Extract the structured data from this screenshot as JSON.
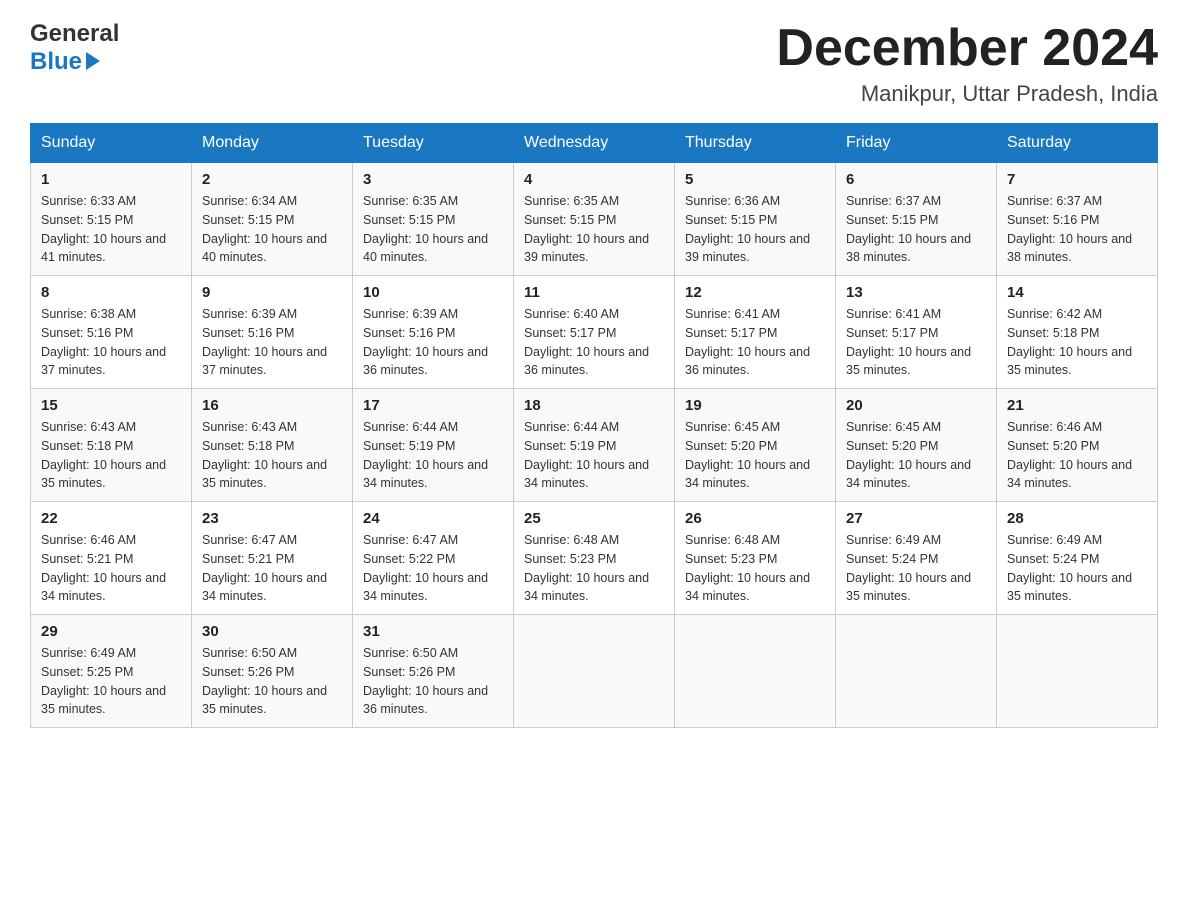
{
  "header": {
    "logo_general": "General",
    "logo_blue": "Blue",
    "month": "December 2024",
    "location": "Manikpur, Uttar Pradesh, India"
  },
  "weekdays": [
    "Sunday",
    "Monday",
    "Tuesday",
    "Wednesday",
    "Thursday",
    "Friday",
    "Saturday"
  ],
  "weeks": [
    [
      {
        "day": "1",
        "sunrise": "6:33 AM",
        "sunset": "5:15 PM",
        "daylight": "10 hours and 41 minutes."
      },
      {
        "day": "2",
        "sunrise": "6:34 AM",
        "sunset": "5:15 PM",
        "daylight": "10 hours and 40 minutes."
      },
      {
        "day": "3",
        "sunrise": "6:35 AM",
        "sunset": "5:15 PM",
        "daylight": "10 hours and 40 minutes."
      },
      {
        "day": "4",
        "sunrise": "6:35 AM",
        "sunset": "5:15 PM",
        "daylight": "10 hours and 39 minutes."
      },
      {
        "day": "5",
        "sunrise": "6:36 AM",
        "sunset": "5:15 PM",
        "daylight": "10 hours and 39 minutes."
      },
      {
        "day": "6",
        "sunrise": "6:37 AM",
        "sunset": "5:15 PM",
        "daylight": "10 hours and 38 minutes."
      },
      {
        "day": "7",
        "sunrise": "6:37 AM",
        "sunset": "5:16 PM",
        "daylight": "10 hours and 38 minutes."
      }
    ],
    [
      {
        "day": "8",
        "sunrise": "6:38 AM",
        "sunset": "5:16 PM",
        "daylight": "10 hours and 37 minutes."
      },
      {
        "day": "9",
        "sunrise": "6:39 AM",
        "sunset": "5:16 PM",
        "daylight": "10 hours and 37 minutes."
      },
      {
        "day": "10",
        "sunrise": "6:39 AM",
        "sunset": "5:16 PM",
        "daylight": "10 hours and 36 minutes."
      },
      {
        "day": "11",
        "sunrise": "6:40 AM",
        "sunset": "5:17 PM",
        "daylight": "10 hours and 36 minutes."
      },
      {
        "day": "12",
        "sunrise": "6:41 AM",
        "sunset": "5:17 PM",
        "daylight": "10 hours and 36 minutes."
      },
      {
        "day": "13",
        "sunrise": "6:41 AM",
        "sunset": "5:17 PM",
        "daylight": "10 hours and 35 minutes."
      },
      {
        "day": "14",
        "sunrise": "6:42 AM",
        "sunset": "5:18 PM",
        "daylight": "10 hours and 35 minutes."
      }
    ],
    [
      {
        "day": "15",
        "sunrise": "6:43 AM",
        "sunset": "5:18 PM",
        "daylight": "10 hours and 35 minutes."
      },
      {
        "day": "16",
        "sunrise": "6:43 AM",
        "sunset": "5:18 PM",
        "daylight": "10 hours and 35 minutes."
      },
      {
        "day": "17",
        "sunrise": "6:44 AM",
        "sunset": "5:19 PM",
        "daylight": "10 hours and 34 minutes."
      },
      {
        "day": "18",
        "sunrise": "6:44 AM",
        "sunset": "5:19 PM",
        "daylight": "10 hours and 34 minutes."
      },
      {
        "day": "19",
        "sunrise": "6:45 AM",
        "sunset": "5:20 PM",
        "daylight": "10 hours and 34 minutes."
      },
      {
        "day": "20",
        "sunrise": "6:45 AM",
        "sunset": "5:20 PM",
        "daylight": "10 hours and 34 minutes."
      },
      {
        "day": "21",
        "sunrise": "6:46 AM",
        "sunset": "5:20 PM",
        "daylight": "10 hours and 34 minutes."
      }
    ],
    [
      {
        "day": "22",
        "sunrise": "6:46 AM",
        "sunset": "5:21 PM",
        "daylight": "10 hours and 34 minutes."
      },
      {
        "day": "23",
        "sunrise": "6:47 AM",
        "sunset": "5:21 PM",
        "daylight": "10 hours and 34 minutes."
      },
      {
        "day": "24",
        "sunrise": "6:47 AM",
        "sunset": "5:22 PM",
        "daylight": "10 hours and 34 minutes."
      },
      {
        "day": "25",
        "sunrise": "6:48 AM",
        "sunset": "5:23 PM",
        "daylight": "10 hours and 34 minutes."
      },
      {
        "day": "26",
        "sunrise": "6:48 AM",
        "sunset": "5:23 PM",
        "daylight": "10 hours and 34 minutes."
      },
      {
        "day": "27",
        "sunrise": "6:49 AM",
        "sunset": "5:24 PM",
        "daylight": "10 hours and 35 minutes."
      },
      {
        "day": "28",
        "sunrise": "6:49 AM",
        "sunset": "5:24 PM",
        "daylight": "10 hours and 35 minutes."
      }
    ],
    [
      {
        "day": "29",
        "sunrise": "6:49 AM",
        "sunset": "5:25 PM",
        "daylight": "10 hours and 35 minutes."
      },
      {
        "day": "30",
        "sunrise": "6:50 AM",
        "sunset": "5:26 PM",
        "daylight": "10 hours and 35 minutes."
      },
      {
        "day": "31",
        "sunrise": "6:50 AM",
        "sunset": "5:26 PM",
        "daylight": "10 hours and 36 minutes."
      },
      null,
      null,
      null,
      null
    ]
  ]
}
